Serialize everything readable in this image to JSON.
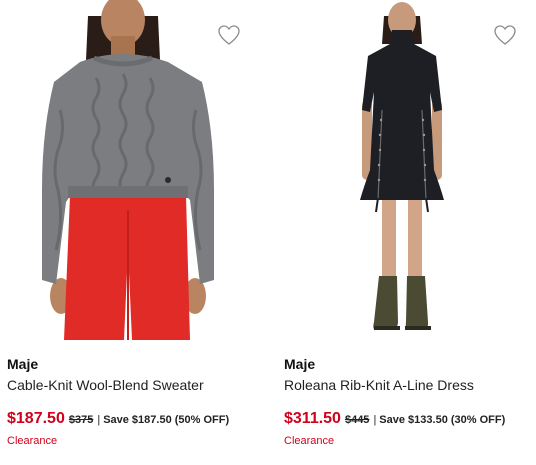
{
  "products": [
    {
      "brand": "Maje",
      "title": "Cable-Knit Wool-Blend Sweater",
      "sale_price": "$187.50",
      "original_price": "$375",
      "separator": "|",
      "savings": "Save $187.50 (50% OFF)",
      "badge": "Clearance",
      "image": "model-wearing-grey-cable-knit-sweater-and-red-trousers",
      "favorite_icon": "heart-outline-icon"
    },
    {
      "brand": "Maje",
      "title": "Roleana Rib-Knit A-Line Dress",
      "sale_price": "$311.50",
      "original_price": "$445",
      "separator": "|",
      "savings": "Save $133.50 (30% OFF)",
      "badge": "Clearance",
      "image": "model-wearing-black-rib-knit-dress-and-olive-boots",
      "favorite_icon": "heart-outline-icon"
    }
  ],
  "colors": {
    "sale": "#d0021b",
    "text": "#1a1a1a",
    "sweater": "#7b7d80",
    "trousers": "#e02b26",
    "dress": "#1d1f24",
    "boots": "#4a4b32"
  }
}
